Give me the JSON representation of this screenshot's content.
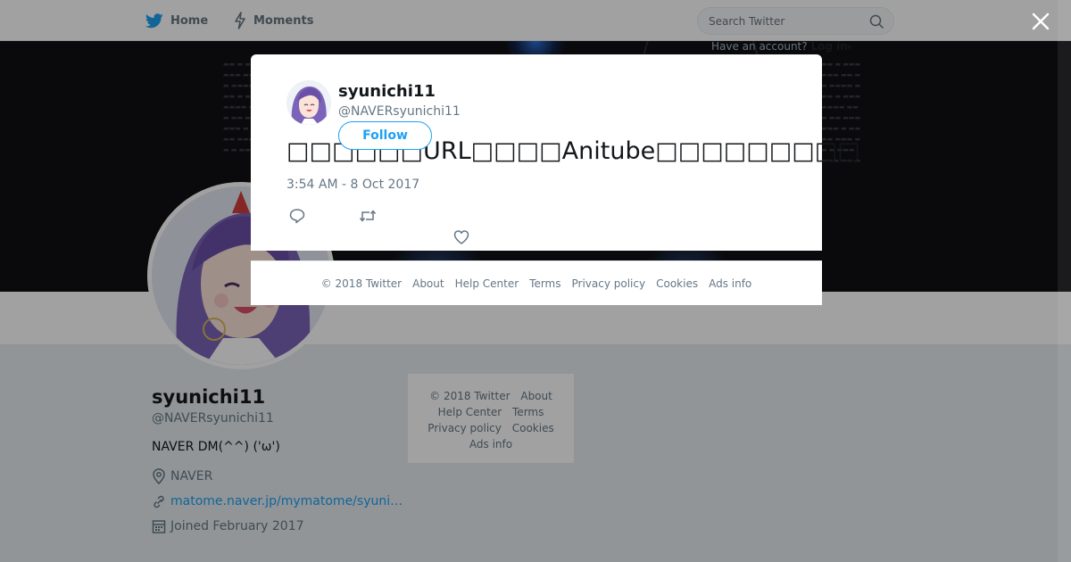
{
  "header": {
    "nav": [
      {
        "label": "Home",
        "icon": "twitter-bird-icon"
      },
      {
        "label": "Moments",
        "icon": "lightning-icon"
      }
    ],
    "search": {
      "placeholder": "Search Twitter",
      "icon": "search-icon"
    },
    "account_prompt": "Have an account?",
    "login_label": "Log in"
  },
  "profile": {
    "name": "syunichi11",
    "handle": "@NAVERsyunichi11",
    "bio": "NAVER DM(^^) ('ω')",
    "location": "NAVER",
    "url": "matome.naver.jp/mymatome/syuni…",
    "joined": "Joined February 2017"
  },
  "side_footer": {
    "copyright": "© 2018 Twitter",
    "links": [
      "About",
      "Help Center",
      "Terms",
      "Privacy policy",
      "Cookies",
      "Ads info"
    ]
  },
  "tweet": {
    "author_name": "syunichi11",
    "author_handle": "@NAVERsyunichi11",
    "follow_label": "Follow",
    "text": "□□□□□□URL□□□□Anitube□□□□□□□□□",
    "timestamp": "3:54 AM - 8 Oct 2017",
    "actions": [
      "reply-icon",
      "retweet-icon",
      "like-icon"
    ]
  },
  "modal_footer": {
    "copyright": "© 2018 Twitter",
    "links": [
      "About",
      "Help Center",
      "Terms",
      "Privacy policy",
      "Cookies",
      "Ads info"
    ]
  },
  "colors": {
    "brand": "#1da1f2",
    "overlay": "rgba(0,0,0,0.37)",
    "secondary_text": "#657786"
  }
}
